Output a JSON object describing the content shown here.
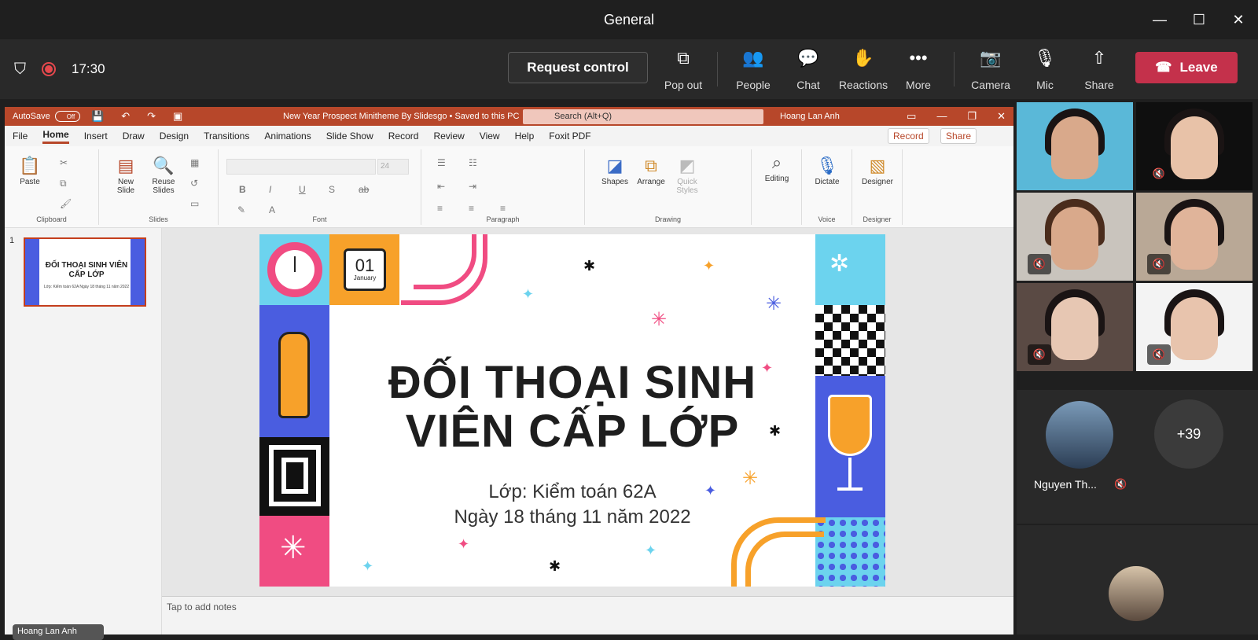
{
  "window": {
    "title": "General"
  },
  "toolbar": {
    "time": "17:30",
    "request_control": "Request control",
    "pop_out": "Pop out",
    "people": "People",
    "chat": "Chat",
    "reactions": "Reactions",
    "more": "More",
    "camera": "Camera",
    "mic": "Mic",
    "share": "Share",
    "leave": "Leave",
    "leave_color": "#c4314b"
  },
  "ppt": {
    "autosave": "AutoSave",
    "autosave_state": "Off",
    "doc_title": "New Year Prospect Minitheme By Slidesgo • Saved to this PC",
    "search": "Search (Alt+Q)",
    "user": "Hoang Lan Anh",
    "accent": "#b7472a",
    "menu": [
      "File",
      "Home",
      "Insert",
      "Draw",
      "Design",
      "Transitions",
      "Animations",
      "Slide Show",
      "Record",
      "Review",
      "View",
      "Help",
      "Foxit PDF"
    ],
    "record_btn": "Record",
    "share_btn": "Share",
    "ribbon": {
      "paste": "Paste",
      "clipboard": "Clipboard",
      "new_slide": "New Slide",
      "reuse_slides": "Reuse Slides",
      "slides": "Slides",
      "font_size": "24",
      "font": "Font",
      "paragraph": "Paragraph",
      "shapes": "Shapes",
      "arrange": "Arrange",
      "quick_styles": "Quick Styles",
      "drawing": "Drawing",
      "editing": "Editing",
      "dictate": "Dictate",
      "voice": "Voice",
      "designer_btn": "Designer",
      "designer": "Designer"
    },
    "slide_number": "1",
    "thumb_title": "ĐỐI THOẠI SINH VIÊN CẤP LỚP",
    "thumb_sub": "Lớp: Kiểm toán 62A Ngày 18 tháng 11 năm 2022",
    "notes": "Tap to add notes"
  },
  "slide": {
    "title_line1": "ĐỐI THOẠI SINH",
    "title_line2": "VIÊN CẤP LỚP",
    "sub_line1": "Lớp: Kiểm toán 62A",
    "sub_line2": "Ngày 18 tháng 11 năm 2022",
    "calendar_day": "01",
    "calendar_month": "January"
  },
  "participants": {
    "named": "Nguyen Th...",
    "more_count": "+39",
    "presenter_chip": "Hoang Lan Anh"
  }
}
